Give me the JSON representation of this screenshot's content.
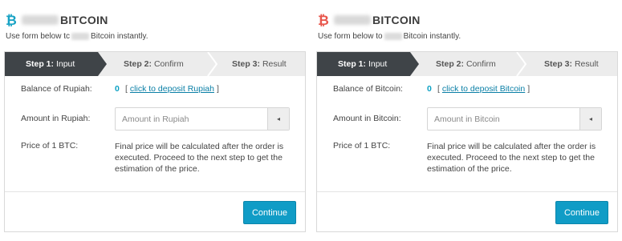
{
  "panels": [
    {
      "coin_icon": "₿",
      "coin_color": "#17a2c4",
      "title": "BITCOIN",
      "subtitle_before": "Use form below tc",
      "subtitle_after": "Bitcoin instantly.",
      "steps": [
        {
          "prefix": "Step 1:",
          "label": "Input"
        },
        {
          "prefix": "Step 2:",
          "label": "Confirm"
        },
        {
          "prefix": "Step 3:",
          "label": "Result"
        }
      ],
      "balance_label": "Balance of Rupiah:",
      "balance_value": "0",
      "deposit_open": "[",
      "deposit_link": "click to deposit Rupiah",
      "deposit_close": "]",
      "amount_label": "Amount in Rupiah:",
      "amount_value": "",
      "amount_placeholder": "Amount in Rupiah",
      "addon_icon": "◂",
      "price_label": "Price of 1 BTC:",
      "price_desc": "Final price will be calculated after the order is executed. Proceed to the next step to get the estimation of the price.",
      "continue_label": "Continue"
    },
    {
      "coin_icon": "₿",
      "coin_color": "#e8554b",
      "title": "BITCOIN",
      "subtitle_before": "Use form below to",
      "subtitle_after": "Bitcoin instantly.",
      "steps": [
        {
          "prefix": "Step 1:",
          "label": "Input"
        },
        {
          "prefix": "Step 2:",
          "label": "Confirm"
        },
        {
          "prefix": "Step 3:",
          "label": "Result"
        }
      ],
      "balance_label": "Balance of Bitcoin:",
      "balance_value": "0",
      "deposit_open": "[",
      "deposit_link": "click to deposit Bitcoin",
      "deposit_close": "]",
      "amount_label": "Amount in Bitcoin:",
      "amount_value": "",
      "amount_placeholder": "Amount in Bitcoin",
      "addon_icon": "◂",
      "price_label": "Price of 1 BTC:",
      "price_desc": "Final price will be calculated after the order is executed. Proceed to the next step to get the estimation of the price.",
      "continue_label": "Continue"
    }
  ]
}
